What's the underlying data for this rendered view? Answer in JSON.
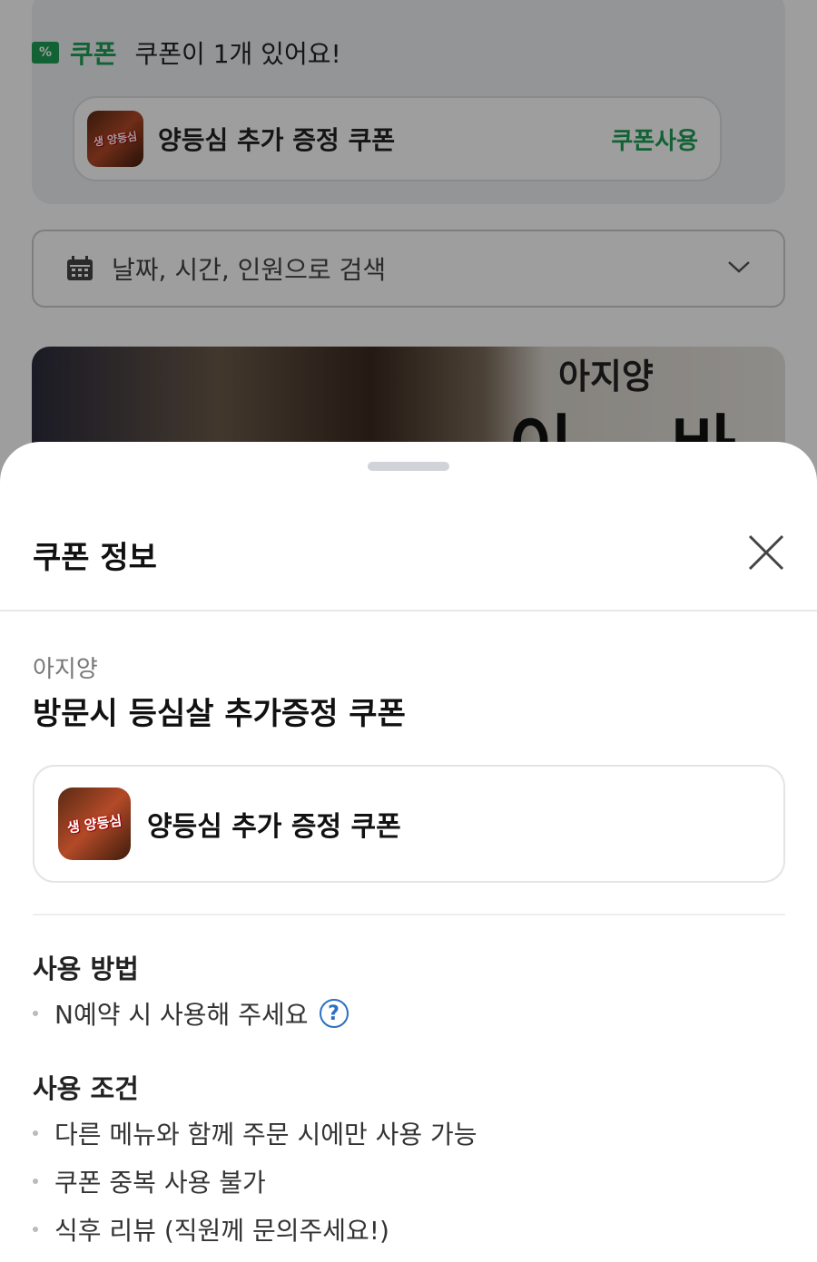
{
  "background": {
    "coupon_banner": {
      "label": "쿠폰",
      "count_text": "쿠폰이 1개 있어요!",
      "coupon_title": "양등심 추가 증정 쿠폰",
      "use_label": "쿠폰사용",
      "thumb_text": "생 양등심"
    },
    "search": {
      "placeholder": "날짜, 시간, 인원으로 검색"
    },
    "banner": {
      "sub": "아지양",
      "big": "이 바"
    }
  },
  "sheet": {
    "title": "쿠폰 정보",
    "shop_name": "아지양",
    "coupon_name": "방문시 등심살 추가증정 쿠폰",
    "card": {
      "thumb_text": "생 양등심",
      "title": "양등심 추가 증정 쿠폰"
    },
    "usage": {
      "title": "사용 방법",
      "items": [
        "N예약 시 사용해 주세요"
      ],
      "help_glyph": "?"
    },
    "conditions": {
      "title": "사용 조건",
      "items": [
        "다른 메뉴와 함께 주문 시에만 사용 가능",
        "쿠폰 중복 사용 불가",
        "식후 리뷰 (직원께 문의주세요!)"
      ]
    }
  },
  "colors": {
    "accent_green": "#1f9e57",
    "help_blue": "#2c6fc2",
    "dim_overlay": "rgba(0,0,0,0.38)"
  }
}
